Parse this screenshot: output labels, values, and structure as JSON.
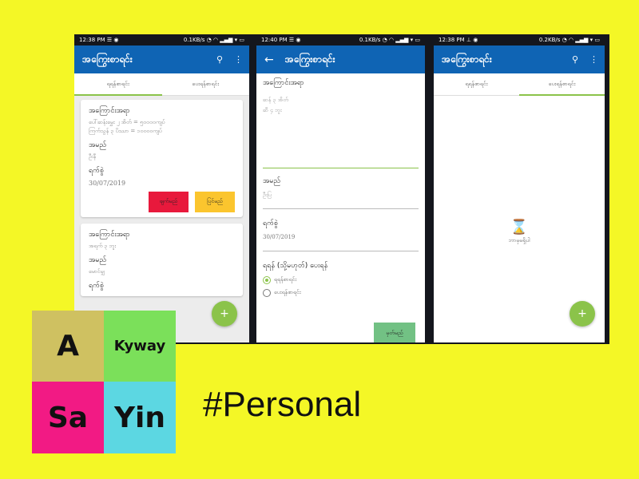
{
  "colors": {
    "background": "#f4f726",
    "appbar": "#0f64b4",
    "accent_green": "#8bc34a",
    "delete_red": "#e8193c",
    "edit_yellow": "#fbc52e",
    "save_green": "#72c184",
    "logo_a": "#cfc161",
    "logo_kyway": "#7be05a",
    "logo_sa": "#f21a84",
    "logo_yin": "#5cd7e2"
  },
  "screen1": {
    "status_left": "12:38 PM ☰ ◉",
    "status_right": "0.1KB/s ◔ ◠ ▂▄▆ ▾ ▭",
    "title": "အကြွေးစာရင်း",
    "search_icon": "search-icon",
    "menu_icon": "more-vert-icon",
    "tabs": [
      "ရရန်စာရင်း",
      "ပေးရန်စာရင်း"
    ],
    "cards": [
      {
        "heading": "အကြောင်းအရာ",
        "details": [
          "ပေါ်ဆန်းမွှေး ၂ အိတ် = ၅၀၀၀၀ကျပ်",
          "ကြက်သွန် ၃ ပိဿာ = ၁၀၀၀၀ကျပ်"
        ],
        "name_label": "အမည်",
        "name_value": "ဦးနီ",
        "date_label": "ရက်စွဲ",
        "date_value": "30/07/2019",
        "delete_label": "ဖျက်မည်",
        "edit_label": "ပြင်မည်"
      },
      {
        "heading": "အကြောင်းအရာ",
        "details": [
          "အရက် ၃ ဘူး"
        ],
        "name_label": "အမည်",
        "name_value": "မောင်မျှ",
        "date_label": "ရက်စွဲ"
      }
    ],
    "fab": "+"
  },
  "screen2": {
    "status_left": "12:40 PM ☰ ◉",
    "status_right": "0.1KB/s ◔ ◠ ▂▄▆ ▾ ▭",
    "back_icon": "←",
    "title": "အကြွေးစာရင်း",
    "subject_label": "အကြောင်းအရာ",
    "subject_lines": [
      "ဆန် ၃ အိတ်",
      "ဆီ ၄ ဘူး"
    ],
    "name_label": "အမည်",
    "name_value": "ဦးပြ",
    "date_label": "ရက်စွဲ",
    "date_value": "30/07/2019",
    "type_label": "ရရန် (သို့မဟုတ်) ပေးရန်",
    "radio_options": [
      "ရရန်စာရင်း",
      "ပေးရန်စာရင်း"
    ],
    "save_label": "မှတ်မည်"
  },
  "screen3": {
    "status_left": "12:38 PM ⊥ ◉",
    "status_right": "0.2KB/s ◔ ◠ ▂▄▆ ▾ ▭",
    "title": "အကြွေးစာရင်း",
    "tabs": [
      "ရရန်စာရင်း",
      "ပေးရန်စာရင်း"
    ],
    "empty_icon": "⌛",
    "empty_text": "ဘာမှမရှိပါ",
    "fab": "+"
  },
  "logo": {
    "a": "A",
    "kyway": "Kyway",
    "sa": "Sa",
    "yin": "Yin"
  },
  "hashtag": "#Personal"
}
